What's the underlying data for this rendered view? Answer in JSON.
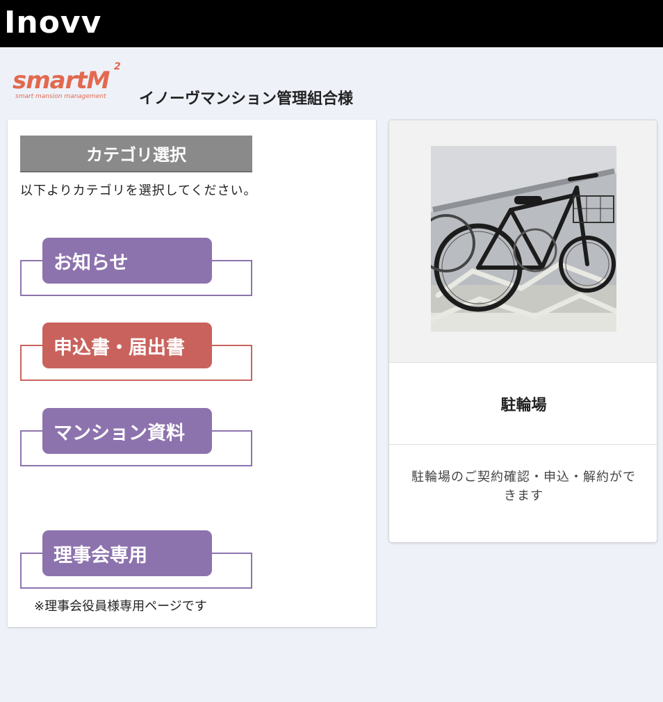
{
  "header": {
    "brand": "Inovv"
  },
  "logo": {
    "main": "smartM",
    "superscript": "2",
    "tagline": "smart mansion management"
  },
  "org_title": "イノーヴマンション管理組合様",
  "category": {
    "header": "カテゴリ選択",
    "description": "以下よりカテゴリを選択してください。",
    "buttons": [
      {
        "label": "お知らせ",
        "color": "#8d73ae"
      },
      {
        "label": "申込書・届出書",
        "color": "#c9625d"
      },
      {
        "label": "マンション資料",
        "color": "#8d73ae"
      },
      {
        "label": "理事会専用",
        "color": "#8d73ae"
      }
    ],
    "note": "※理事会役員様専用ページです"
  },
  "card": {
    "image": "bicycle-photo",
    "title": "駐輪場",
    "description": "駐輪場のご契約確認・申込・解約ができます"
  }
}
